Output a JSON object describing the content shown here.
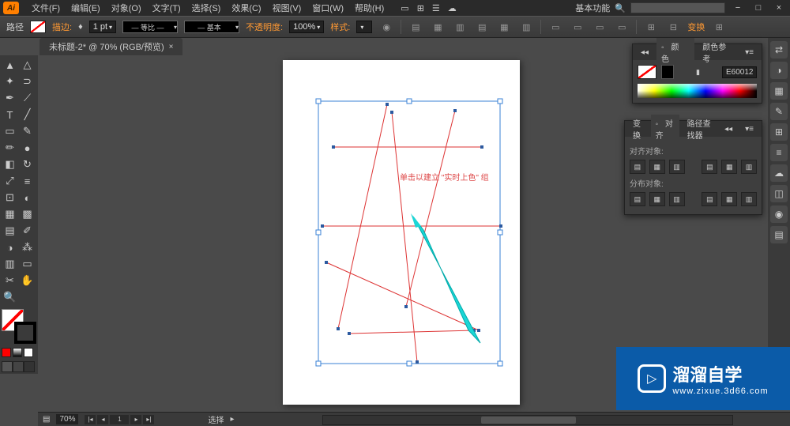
{
  "titlebar": {
    "logo": "Ai",
    "menu": [
      "文件(F)",
      "编辑(E)",
      "对象(O)",
      "文字(T)",
      "选择(S)",
      "效果(C)",
      "视图(V)",
      "窗口(W)",
      "帮助(H)"
    ],
    "workspace_label": "基本功能",
    "window_controls": [
      "−",
      "□",
      "×"
    ]
  },
  "options": {
    "label_path": "路径",
    "stroke_label": "描边:",
    "stroke_weight": "1 pt",
    "stroke_profile": "— 等比 —",
    "stroke_style": "— 基本",
    "opacity_label": "不透明度:",
    "opacity_value": "100%",
    "style_label": "样式:",
    "transform_label": "变换"
  },
  "document": {
    "tab_title": "未标题-2* @ 70% (RGB/预览)"
  },
  "canvas": {
    "hint": "单击以建立 \"实时上色\" 组"
  },
  "colorpanel": {
    "tab1": "颜色",
    "tab2": "颜色参考",
    "hex": "E60012"
  },
  "alignpanel": {
    "tab1": "变换",
    "tab2": "对齐",
    "tab3": "路径查找器",
    "align_label": "对齐对象:",
    "distribute_label": "分布对象:"
  },
  "watermark": {
    "title": "溜溜自学",
    "url": "www.zixue.3d66.com"
  },
  "status": {
    "zoom": "70%",
    "page": "1",
    "tool": "选择"
  }
}
